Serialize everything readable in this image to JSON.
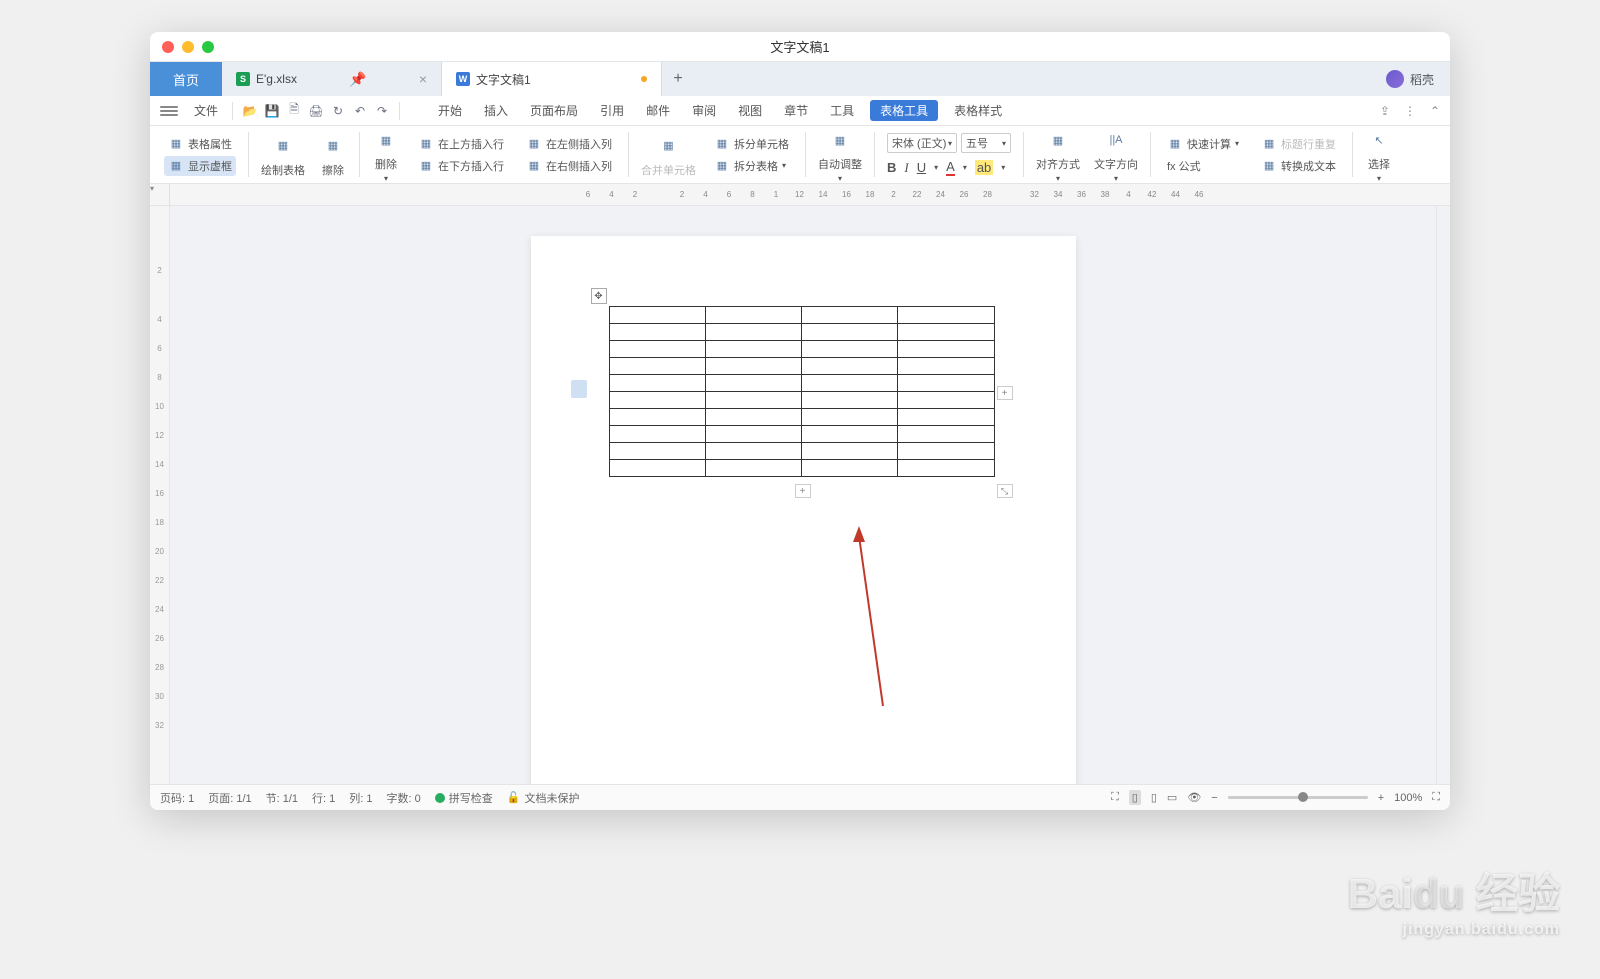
{
  "window": {
    "title": "文字文稿1"
  },
  "tabs": {
    "home": "首页",
    "items": [
      {
        "icon": "S",
        "label": "E'g.xlsx",
        "active": false
      },
      {
        "icon": "W",
        "label": "文字文稿1",
        "active": true,
        "unsaved": true
      }
    ]
  },
  "user": {
    "name": "稻壳"
  },
  "menubar": {
    "file": "文件",
    "tabs": [
      "开始",
      "插入",
      "页面布局",
      "引用",
      "邮件",
      "审阅",
      "视图",
      "章节",
      "工具",
      "表格工具",
      "表格样式"
    ],
    "active_index": 9
  },
  "ribbon": {
    "table_props": "表格属性",
    "show_dashed": "显示虚框",
    "draw_table": "绘制表格",
    "eraser": "擦除",
    "delete": "删除",
    "insert_row_above": "在上方插入行",
    "insert_row_below": "在下方插入行",
    "insert_col_left": "在左侧插入列",
    "insert_col_right": "在右侧插入列",
    "merge_cells": "合并单元格",
    "split_cells": "拆分单元格",
    "split_table": "拆分表格",
    "auto_adjust": "自动调整",
    "font_name": "宋体 (正文)",
    "font_size": "五号",
    "align": "对齐方式",
    "text_dir": "文字方向",
    "quick_calc": "快速计算",
    "header_repeat": "标题行重复",
    "formula": "fx 公式",
    "to_text": "转换成文本",
    "select": "选择"
  },
  "ruler": {
    "h": [
      "6",
      "4",
      "2",
      "",
      "2",
      "4",
      "6",
      "8",
      "1",
      "12",
      "14",
      "16",
      "18",
      "2",
      "22",
      "24",
      "26",
      "28",
      "",
      "32",
      "34",
      "36",
      "38",
      "4",
      "42",
      "44",
      "46"
    ],
    "v": [
      "",
      "2",
      "",
      "4",
      "6",
      "8",
      "10",
      "12",
      "14",
      "16",
      "18",
      "20",
      "22",
      "24",
      "26",
      "28",
      "30",
      "32"
    ]
  },
  "document": {
    "table": {
      "rows": 10,
      "cols": 4
    }
  },
  "status": {
    "page_no": "页码: 1",
    "page": "页面: 1/1",
    "section": "节: 1/1",
    "line": "行: 1",
    "col": "列: 1",
    "words": "字数: 0",
    "spellcheck": "拼写检查",
    "unprotected": "文档未保护",
    "zoom": "100%"
  },
  "watermark": {
    "brand": "Bai",
    "brand2": "du",
    "text": "经验",
    "url": "jingyan.baidu.com"
  }
}
